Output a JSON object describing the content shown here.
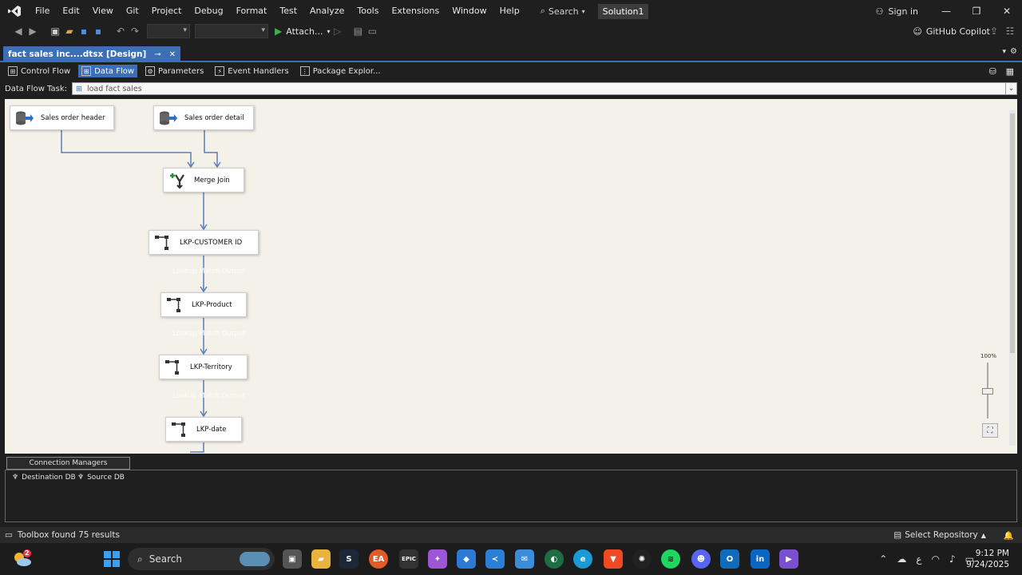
{
  "menubar": {
    "items": [
      "File",
      "Edit",
      "View",
      "Git",
      "Project",
      "Debug",
      "Format",
      "Test",
      "Analyze",
      "Tools",
      "Extensions",
      "Window",
      "Help"
    ],
    "search_label": "Search",
    "solution_name": "Solution1",
    "sign_in": "Sign in"
  },
  "toolbar": {
    "attach_label": "Attach...",
    "copilot_label": "GitHub Copilot"
  },
  "document_tab": {
    "title": "fact sales inc....dtsx [Design]"
  },
  "designer_tabs": [
    "Control Flow",
    "Data Flow",
    "Parameters",
    "Event Handlers",
    "Package Explor..."
  ],
  "task": {
    "label": "Data Flow Task:",
    "value": "load fact sales"
  },
  "components": {
    "sales_order_header": "Sales order header",
    "sales_order_detail": "Sales order detail",
    "merge_join": "Merge Join",
    "lkp_customer": "LKP-CUSTOMER ID",
    "lkp_product": "LKP-Product",
    "lkp_territory": "LKP-Territory",
    "lkp_date": "LKP-date",
    "faint_label": "Lookup Match Output"
  },
  "zoom": "100%",
  "connection_managers": {
    "header": "Connection Managers",
    "items": [
      "Destination DB",
      "Source DB"
    ]
  },
  "status": {
    "left": "Toolbox found 75 results",
    "right": "Select Repository"
  },
  "taskbar": {
    "search_label": "Search",
    "weather_badge": "2",
    "tray_lang": "ع",
    "time": "9:12 PM",
    "date": "9/24/2025"
  },
  "colors": {
    "accent": "#3c6fb5",
    "canvas": "#f4f1e9",
    "connector": "#5b7fb8",
    "vs_purple": "#7b4fd1"
  }
}
